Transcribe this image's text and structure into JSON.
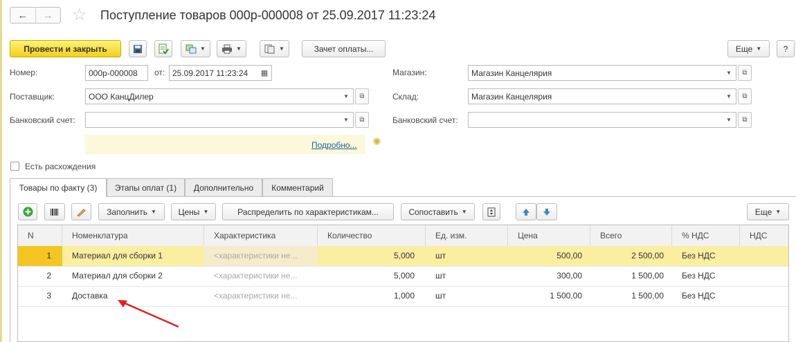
{
  "window": {
    "title": "Поступление товаров 000р-000008 от 25.09.2017 11:23:24",
    "back_icon": "←",
    "forward_icon": "→",
    "star_icon": "☆"
  },
  "toolbar": {
    "post_close": "Провести и закрыть",
    "payment_offset": "Зачет оплаты...",
    "more": "Еще",
    "help": "?"
  },
  "form": {
    "number_label": "Номер:",
    "number_value": "000р-000008",
    "from_label": "от:",
    "date_value": "25.09.2017 11:23:24",
    "supplier_label": "Поставщик:",
    "supplier_value": "ООО КанцДилер",
    "bank_label": "Банковский счет:",
    "bank_value": "",
    "store_label": "Магазин:",
    "store_value": "Магазин Канцелярия",
    "warehouse_label": "Склад:",
    "warehouse_value": "Магазин Канцелярия",
    "bank2_label": "Банковский счет:",
    "bank2_value": "",
    "details_link": "Подробно...",
    "discrepancy_label": "Есть расхождения"
  },
  "tabs": [
    {
      "label": "Товары по факту (3)",
      "active": true
    },
    {
      "label": "Этапы оплат (1)",
      "active": false
    },
    {
      "label": "Дополнительно",
      "active": false
    },
    {
      "label": "Комментарий",
      "active": false
    }
  ],
  "table_toolbar": {
    "fill": "Заполнить",
    "prices": "Цены",
    "distribute": "Распределить по характеристикам...",
    "match": "Сопоставить",
    "more": "Еще"
  },
  "table": {
    "columns": [
      "N",
      "Номенклатура",
      "Характеристика",
      "Количество",
      "Ед. изм.",
      "Цена",
      "Всего",
      "% НДС",
      "НДС"
    ],
    "rows": [
      {
        "n": "1",
        "item": "Материал для сборки 1",
        "char": "<характеристики не...",
        "qty": "5,000",
        "unit": "шт",
        "price": "500,00",
        "total": "2 500,00",
        "vat_rate": "Без НДС",
        "vat": "",
        "selected": true
      },
      {
        "n": "2",
        "item": "Материал для сборки 2",
        "char": "<характеристики не...",
        "qty": "5,000",
        "unit": "шт",
        "price": "300,00",
        "total": "1 500,00",
        "vat_rate": "Без НДС",
        "vat": "",
        "selected": false
      },
      {
        "n": "3",
        "item": "Доставка",
        "char": "<характеристики не...",
        "qty": "1,000",
        "unit": "шт",
        "price": "1 500,00",
        "total": "1 500,00",
        "vat_rate": "Без НДС",
        "vat": "",
        "selected": false
      }
    ]
  },
  "colors": {
    "primary_button": "#f3d01b",
    "selected_row": "#fbeea1",
    "annotation_arrow": "#e02020"
  }
}
